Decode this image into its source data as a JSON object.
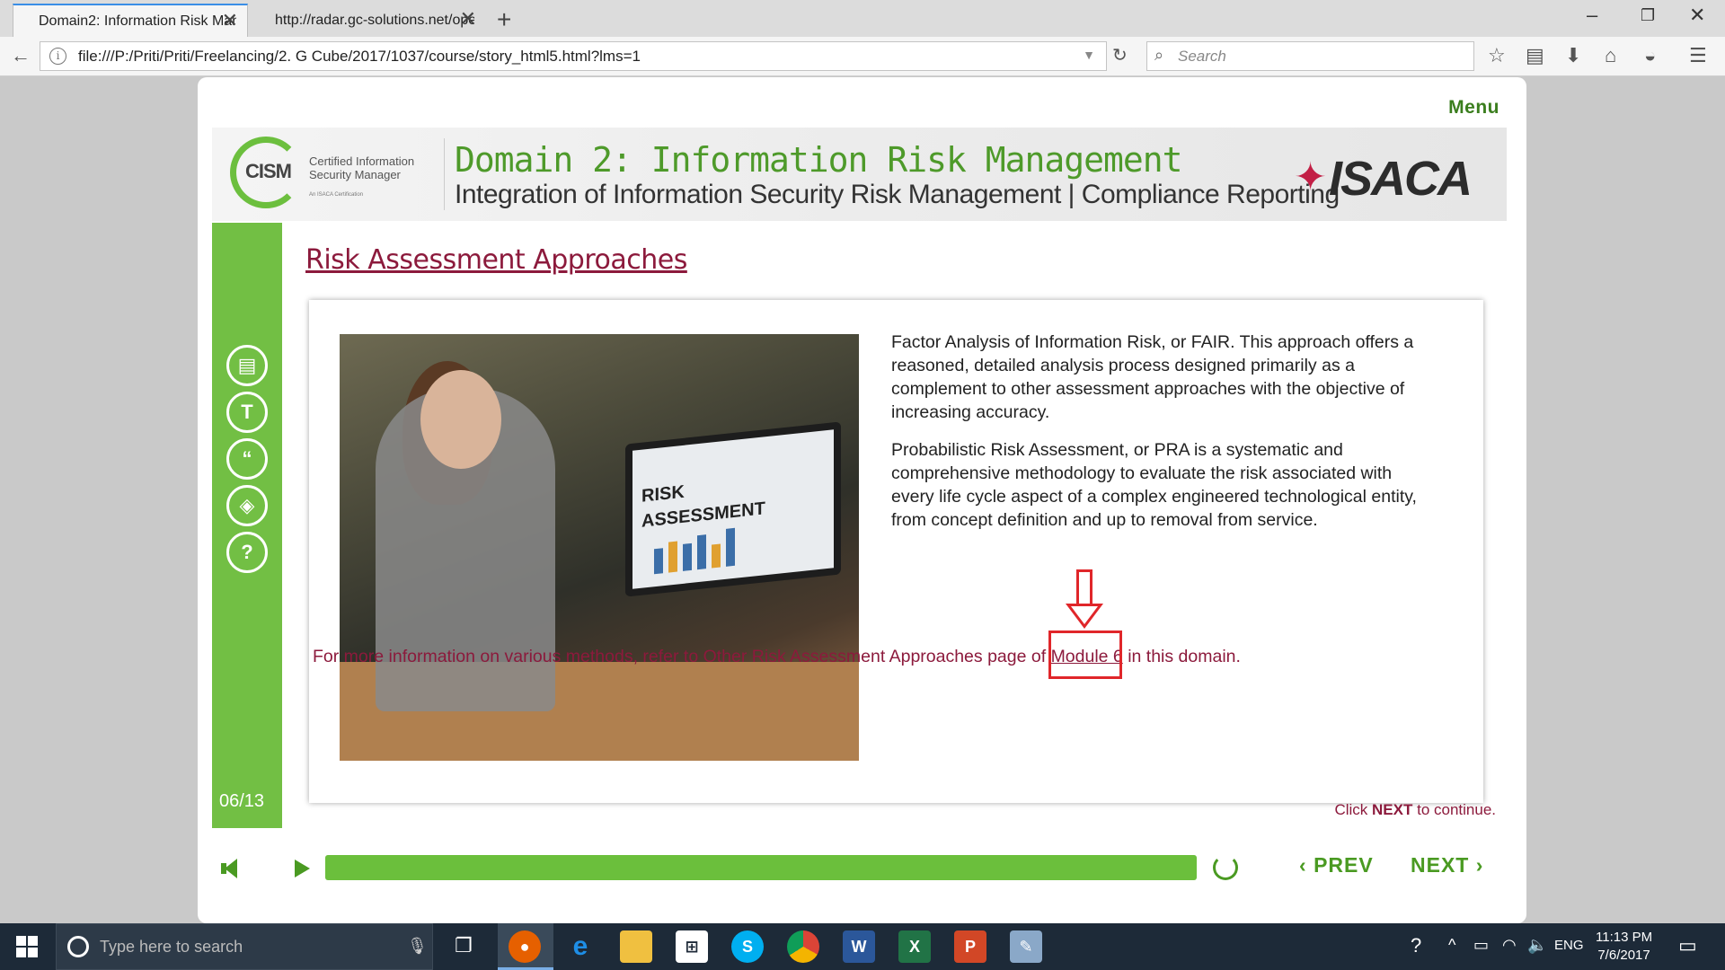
{
  "browser": {
    "tabs": [
      {
        "label": "Domain2: Information Risk Mana"
      },
      {
        "label": "http://radar.gc-solutions.net/ope"
      }
    ],
    "url": "file:///P:/Priti/Priti/Freelancing/2. G Cube/2017/1037/course/story_html5.html?lms=1",
    "search_placeholder": "Search"
  },
  "course": {
    "menu_label": "Menu",
    "logo": {
      "acronym": "CISM",
      "line1": "Certified Information",
      "line2": "Security Manager",
      "tiny": "An ISACA Certification",
      "isaca": "ISACA"
    },
    "header": {
      "title": "Domain 2: Information Risk Management",
      "subtitle": "Integration of Information Security Risk Management | Compliance Reporting"
    },
    "slide_title": "Risk Assessment Approaches",
    "image": {
      "monitor_line1": "RISK",
      "monitor_line2": "ASSESSMENT"
    },
    "paragraphs": [
      "Factor Analysis of Information Risk, or FAIR. This approach offers a reasoned, detailed analysis process designed primarily as a complement to other assessment approaches with the objective of increasing accuracy.",
      "Probabilistic Risk Assessment, or PRA is a systematic and comprehensive methodology to evaluate the risk associated with every life cycle aspect of a complex engineered technological entity, from concept definition and up to removal from service."
    ],
    "more_info": {
      "prefix": "For more information on various methods, refer to Other Risk Assessment Approaches page of ",
      "link": "Module 6",
      "suffix": " in this domain."
    },
    "click_next": {
      "pre": "Click ",
      "bold": "NEXT",
      "post": " to continue."
    },
    "page_counter": "06/13",
    "sidebar_icons": [
      "notes-icon",
      "transcript-icon",
      "quote-icon",
      "resources-icon",
      "help-icon"
    ],
    "sidebar_glyphs": [
      "▤",
      "T",
      "“",
      "◈",
      "?"
    ],
    "progress_fraction": 1.0,
    "prev_label": "PREV",
    "next_label": "NEXT",
    "colors": {
      "accent_green": "#72bf44",
      "title_maroon": "#8c1a3c",
      "annotation_red": "#e0262a"
    }
  },
  "taskbar": {
    "search_placeholder": "Type here to search",
    "language": "ENG",
    "time": "11:13 PM",
    "date": "7/6/2017",
    "apps": [
      "firefox-icon",
      "edge-icon",
      "file-explorer-icon",
      "store-icon",
      "skype-icon",
      "chrome-icon",
      "word-icon",
      "excel-icon",
      "powerpoint-icon",
      "paint-icon"
    ]
  }
}
